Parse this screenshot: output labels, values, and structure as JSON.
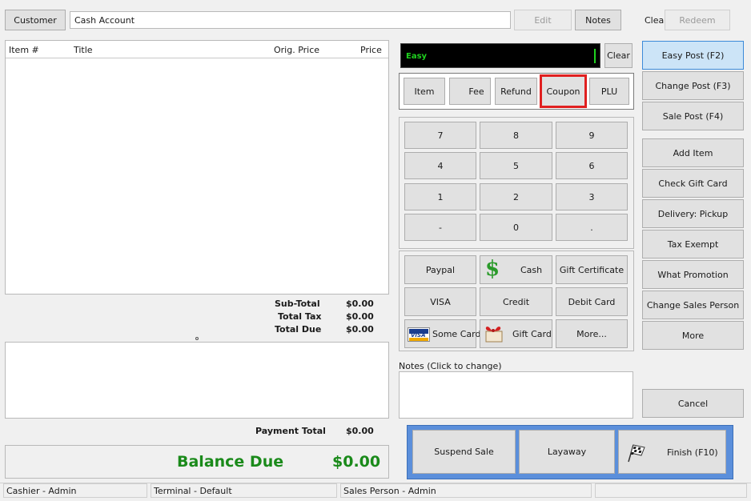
{
  "topbar": {
    "customer_label": "Customer",
    "customer_value": "Cash Account",
    "edit_label": "Edit",
    "notes_label": "Notes",
    "clear_label": "Clear",
    "redeem_label": "Redeem"
  },
  "grid": {
    "columns": [
      "Item #",
      "Title",
      "Orig. Price",
      "Price"
    ]
  },
  "totals": {
    "subtotal_label": "Sub-Total",
    "subtotal_value": "$0.00",
    "tax_label": "Total Tax",
    "tax_value": "$0.00",
    "due_label": "Total Due",
    "due_value": "$0.00",
    "payment_label": "Payment Total",
    "payment_value": "$0.00",
    "balance_label": "Balance Due",
    "balance_value": "$0.00",
    "balance_color": "#1a8a1a"
  },
  "entry": {
    "mode": "Easy",
    "clear_label": "Clear"
  },
  "entry_types": [
    "Item",
    "Fee",
    "Refund",
    "Coupon",
    "PLU"
  ],
  "keypad": [
    "7",
    "8",
    "9",
    "4",
    "5",
    "6",
    "1",
    "2",
    "3",
    "-",
    "0",
    "."
  ],
  "tenders": [
    {
      "label": "Paypal",
      "icon": ""
    },
    {
      "label": "Cash",
      "icon": "dollar-icon"
    },
    {
      "label": "Gift Certificate",
      "icon": ""
    },
    {
      "label": "VISA",
      "icon": ""
    },
    {
      "label": "Credit",
      "icon": ""
    },
    {
      "label": "Debit Card",
      "icon": ""
    },
    {
      "label": "Some Card",
      "icon": "visa-card-icon"
    },
    {
      "label": "Gift Card",
      "icon": "gift-card-icon"
    },
    {
      "label": "More...",
      "icon": ""
    }
  ],
  "notes": {
    "label": "Notes (Click to change)"
  },
  "actions": [
    "Easy Post (F2)",
    "Change Post (F3)",
    "Sale Post (F4)",
    "Add Item",
    "Check Gift Card",
    "Delivery: Pickup",
    "Tax Exempt",
    "What Promotion",
    "Change Sales Person",
    "More"
  ],
  "cancel_label": "Cancel",
  "bottom": {
    "suspend_label": "Suspend Sale",
    "layaway_label": "Layaway",
    "finish_label": "Finish (F10)"
  },
  "status": {
    "cashier": "Cashier - Admin",
    "terminal": "Terminal - Default",
    "sales_person": "Sales Person - Admin"
  },
  "colors": {
    "highlight_border": "#e02020",
    "active_blue": "#3c8ad9",
    "entry_text": "#1fd21f"
  }
}
